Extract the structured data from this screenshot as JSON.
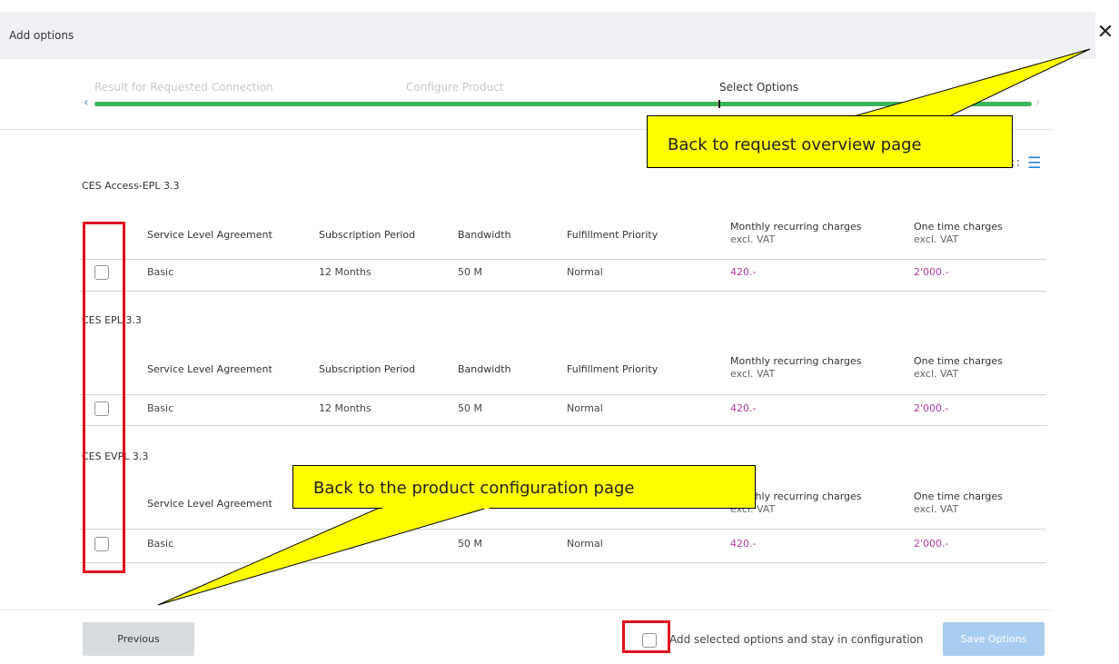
{
  "header": {
    "title": "Add options",
    "close_label": "✕"
  },
  "stepper": {
    "steps": [
      {
        "label": "Result for Requested Connection",
        "state": "done"
      },
      {
        "label": "Configure Product",
        "state": "done"
      },
      {
        "label": "Select Options",
        "state": "current"
      }
    ],
    "prev_arrow": "‹",
    "next_arrow": "›"
  },
  "view_toggle": {
    "grid_icon": "grid-icon",
    "list_icon": "list-icon"
  },
  "table_headers": {
    "sla": "Service Level Agreement",
    "period": "Subscription Period",
    "bandwidth": "Bandwidth",
    "priority": "Fulfillment Priority",
    "monthly": "Monthly recurring charges",
    "monthly_sub": "excl. VAT",
    "onetime": "One time charges",
    "onetime_sub": "excl. VAT"
  },
  "groups": [
    {
      "title": "CES Access-EPL 3.3",
      "row": {
        "sla": "Basic",
        "period": "12 Months",
        "bandwidth": "50 M",
        "priority": "Normal",
        "monthly": "420.-",
        "onetime": "2'000.-"
      }
    },
    {
      "title": "CES EPL 3.3",
      "row": {
        "sla": "Basic",
        "period": "12 Months",
        "bandwidth": "50 M",
        "priority": "Normal",
        "monthly": "420.-",
        "onetime": "2'000.-"
      }
    },
    {
      "title": "CES EVPL 3.3",
      "row": {
        "sla": "Basic",
        "period": "",
        "bandwidth": "50 M",
        "priority": "Normal",
        "monthly": "420.-",
        "onetime": "2'000.-"
      }
    }
  ],
  "footer": {
    "previous_label": "Previous",
    "stay_label": "Add selected options and stay in configuration",
    "save_label": "Save Options"
  },
  "annotations": {
    "callout_top": "Back to request overview page",
    "callout_bottom": "Back to the product configuration page"
  },
  "colors": {
    "progress": "#3cb45a",
    "price": "#b23aa2",
    "callout": "#ffff00",
    "highlight": "#e0101e",
    "save_button": "#a9cdf0"
  }
}
